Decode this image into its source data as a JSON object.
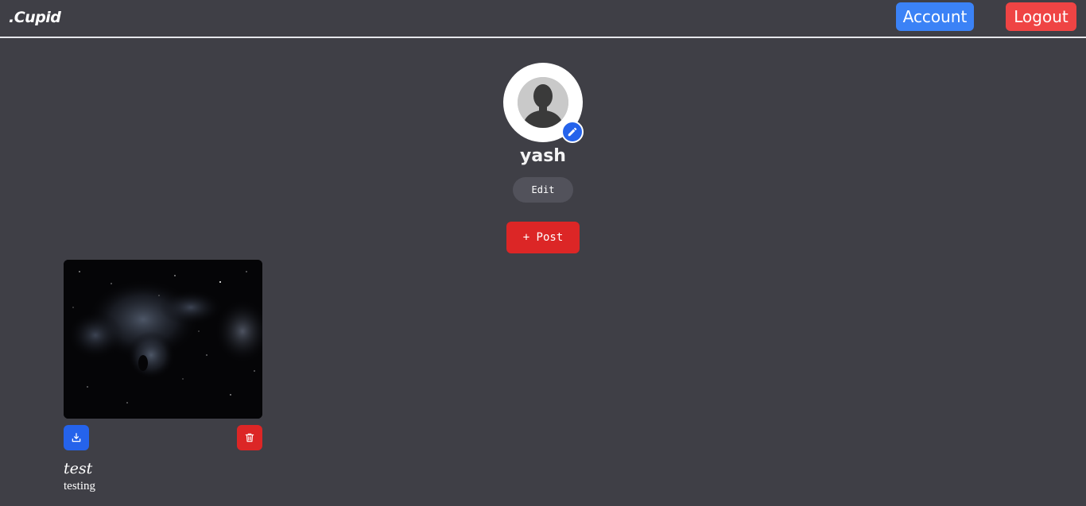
{
  "header": {
    "brand": ".Cupid",
    "account_label": "Account",
    "logout_label": "Logout"
  },
  "profile": {
    "username": "yash",
    "edit_label": "Edit",
    "post_label": "+ Post"
  },
  "posts": [
    {
      "title": "test",
      "description": "testing"
    }
  ],
  "icons": {
    "avatar": "user-silhouette-icon",
    "edit_avatar": "pencil-icon",
    "download": "download-icon",
    "delete": "trash-icon"
  },
  "colors": {
    "background": "#3f3f46",
    "account_button": "#3b82f6",
    "logout_button": "#ef4444",
    "post_button": "#dc2626",
    "edit_button": "#52525b",
    "download_button": "#2563eb",
    "delete_button": "#dc2626"
  }
}
